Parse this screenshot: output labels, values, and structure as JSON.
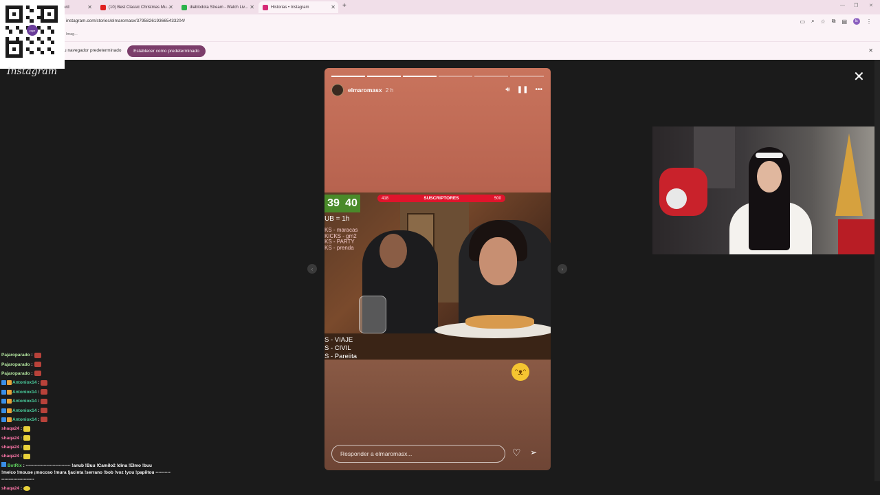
{
  "tabs": [
    {
      "label": "ard",
      "color": "#888888"
    },
    {
      "label": "(10) Best Classic Christmas Mu...",
      "color": "#e02020"
    },
    {
      "label": "diablodota Stream - Watch Liv...",
      "color": "#2bb34a"
    },
    {
      "label": "Historias • Instagram",
      "color": "#d62976",
      "active": true
    }
  ],
  "address": {
    "url": "instagram.com/stories/elmaromasx/3795826193665433204/"
  },
  "bookmarks": {
    "label": "Imag..."
  },
  "infobar": {
    "text": "u navegador predeterminado",
    "button": "Establecer como predeterminado",
    "close": "✕"
  },
  "qr": {
    "logo": "yape"
  },
  "instagram": {
    "logo": "Instagram",
    "close": "✕",
    "story": {
      "username": "elmaromasx",
      "time": "2 h",
      "progress_total": 6,
      "progress_done": 3,
      "reply_placeholder": "Responder a elmaromasx...",
      "overlay": {
        "score_left": "39",
        "score_right": "40",
        "bar_left": "418",
        "bar_label": "SUSCRIPTORES",
        "bar_right": "500",
        "hour": "UB = 1h",
        "list": [
          "KS - maracas",
          "KICKS - gm2",
          "KS - PARTY",
          "KS - prenda"
        ],
        "list2": [
          "S - VIAJE",
          "S - CIVIL",
          "S - Pareiita"
        ]
      },
      "emoji": "laughing-face"
    }
  },
  "chat": [
    {
      "user": "Pajaroparado",
      "color": "#b4e6a0",
      "badges": 0
    },
    {
      "user": "Pajaroparado",
      "color": "#b4e6a0",
      "badges": 0
    },
    {
      "user": "Pajaroparado",
      "color": "#b4e6a0",
      "badges": 0
    },
    {
      "user": "Antoniox14",
      "color": "#4bd1a0",
      "badges": 2
    },
    {
      "user": "Antoniox14",
      "color": "#4bd1a0",
      "badges": 2
    },
    {
      "user": "Antoniox14",
      "color": "#4bd1a0",
      "badges": 2
    },
    {
      "user": "Antoniox14",
      "color": "#4bd1a0",
      "badges": 2
    },
    {
      "user": "Antoniox14",
      "color": "#4bd1a0",
      "badges": 2
    },
    {
      "user": "shaqa24",
      "color": "#ff77aa",
      "badges": 0
    },
    {
      "user": "shaqa24",
      "color": "#ff77aa",
      "badges": 0
    },
    {
      "user": "shaqa24",
      "color": "#ff77aa",
      "badges": 0
    },
    {
      "user": "shaqa24",
      "color": "#ff77aa",
      "badges": 0
    }
  ],
  "botrix": {
    "user": "BotRix",
    "color": "#5fd35f",
    "line1": " : ------------------------------ !anub !Buu !Camilo2 !dina !Elmo !buu",
    "line2": "!melco !mouse ¡mocoso !mura !jacinta !serrano !bob !voz !you !papiitou ----------",
    "line3": "----------------------"
  },
  "last_message": {
    "user": "shaqa24",
    "color": "#ff77aa"
  }
}
